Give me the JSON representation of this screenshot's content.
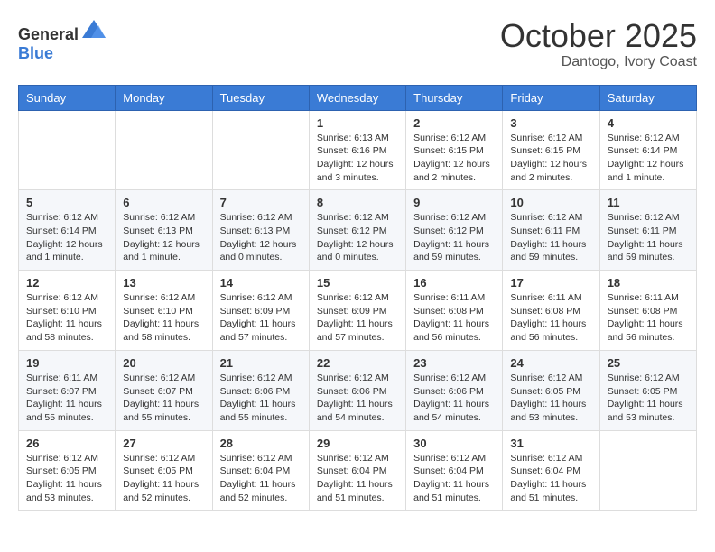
{
  "header": {
    "logo": {
      "general": "General",
      "blue": "Blue"
    },
    "title": "October 2025",
    "subtitle": "Dantogo, Ivory Coast"
  },
  "calendar": {
    "days_of_week": [
      "Sunday",
      "Monday",
      "Tuesday",
      "Wednesday",
      "Thursday",
      "Friday",
      "Saturday"
    ],
    "weeks": [
      [
        {
          "day": "",
          "info": ""
        },
        {
          "day": "",
          "info": ""
        },
        {
          "day": "",
          "info": ""
        },
        {
          "day": "1",
          "info": "Sunrise: 6:13 AM\nSunset: 6:16 PM\nDaylight: 12 hours\nand 3 minutes."
        },
        {
          "day": "2",
          "info": "Sunrise: 6:12 AM\nSunset: 6:15 PM\nDaylight: 12 hours\nand 2 minutes."
        },
        {
          "day": "3",
          "info": "Sunrise: 6:12 AM\nSunset: 6:15 PM\nDaylight: 12 hours\nand 2 minutes."
        },
        {
          "day": "4",
          "info": "Sunrise: 6:12 AM\nSunset: 6:14 PM\nDaylight: 12 hours\nand 1 minute."
        }
      ],
      [
        {
          "day": "5",
          "info": "Sunrise: 6:12 AM\nSunset: 6:14 PM\nDaylight: 12 hours\nand 1 minute."
        },
        {
          "day": "6",
          "info": "Sunrise: 6:12 AM\nSunset: 6:13 PM\nDaylight: 12 hours\nand 1 minute."
        },
        {
          "day": "7",
          "info": "Sunrise: 6:12 AM\nSunset: 6:13 PM\nDaylight: 12 hours\nand 0 minutes."
        },
        {
          "day": "8",
          "info": "Sunrise: 6:12 AM\nSunset: 6:12 PM\nDaylight: 12 hours\nand 0 minutes."
        },
        {
          "day": "9",
          "info": "Sunrise: 6:12 AM\nSunset: 6:12 PM\nDaylight: 11 hours\nand 59 minutes."
        },
        {
          "day": "10",
          "info": "Sunrise: 6:12 AM\nSunset: 6:11 PM\nDaylight: 11 hours\nand 59 minutes."
        },
        {
          "day": "11",
          "info": "Sunrise: 6:12 AM\nSunset: 6:11 PM\nDaylight: 11 hours\nand 59 minutes."
        }
      ],
      [
        {
          "day": "12",
          "info": "Sunrise: 6:12 AM\nSunset: 6:10 PM\nDaylight: 11 hours\nand 58 minutes."
        },
        {
          "day": "13",
          "info": "Sunrise: 6:12 AM\nSunset: 6:10 PM\nDaylight: 11 hours\nand 58 minutes."
        },
        {
          "day": "14",
          "info": "Sunrise: 6:12 AM\nSunset: 6:09 PM\nDaylight: 11 hours\nand 57 minutes."
        },
        {
          "day": "15",
          "info": "Sunrise: 6:12 AM\nSunset: 6:09 PM\nDaylight: 11 hours\nand 57 minutes."
        },
        {
          "day": "16",
          "info": "Sunrise: 6:11 AM\nSunset: 6:08 PM\nDaylight: 11 hours\nand 56 minutes."
        },
        {
          "day": "17",
          "info": "Sunrise: 6:11 AM\nSunset: 6:08 PM\nDaylight: 11 hours\nand 56 minutes."
        },
        {
          "day": "18",
          "info": "Sunrise: 6:11 AM\nSunset: 6:08 PM\nDaylight: 11 hours\nand 56 minutes."
        }
      ],
      [
        {
          "day": "19",
          "info": "Sunrise: 6:11 AM\nSunset: 6:07 PM\nDaylight: 11 hours\nand 55 minutes."
        },
        {
          "day": "20",
          "info": "Sunrise: 6:12 AM\nSunset: 6:07 PM\nDaylight: 11 hours\nand 55 minutes."
        },
        {
          "day": "21",
          "info": "Sunrise: 6:12 AM\nSunset: 6:06 PM\nDaylight: 11 hours\nand 55 minutes."
        },
        {
          "day": "22",
          "info": "Sunrise: 6:12 AM\nSunset: 6:06 PM\nDaylight: 11 hours\nand 54 minutes."
        },
        {
          "day": "23",
          "info": "Sunrise: 6:12 AM\nSunset: 6:06 PM\nDaylight: 11 hours\nand 54 minutes."
        },
        {
          "day": "24",
          "info": "Sunrise: 6:12 AM\nSunset: 6:05 PM\nDaylight: 11 hours\nand 53 minutes."
        },
        {
          "day": "25",
          "info": "Sunrise: 6:12 AM\nSunset: 6:05 PM\nDaylight: 11 hours\nand 53 minutes."
        }
      ],
      [
        {
          "day": "26",
          "info": "Sunrise: 6:12 AM\nSunset: 6:05 PM\nDaylight: 11 hours\nand 53 minutes."
        },
        {
          "day": "27",
          "info": "Sunrise: 6:12 AM\nSunset: 6:05 PM\nDaylight: 11 hours\nand 52 minutes."
        },
        {
          "day": "28",
          "info": "Sunrise: 6:12 AM\nSunset: 6:04 PM\nDaylight: 11 hours\nand 52 minutes."
        },
        {
          "day": "29",
          "info": "Sunrise: 6:12 AM\nSunset: 6:04 PM\nDaylight: 11 hours\nand 51 minutes."
        },
        {
          "day": "30",
          "info": "Sunrise: 6:12 AM\nSunset: 6:04 PM\nDaylight: 11 hours\nand 51 minutes."
        },
        {
          "day": "31",
          "info": "Sunrise: 6:12 AM\nSunset: 6:04 PM\nDaylight: 11 hours\nand 51 minutes."
        },
        {
          "day": "",
          "info": ""
        }
      ]
    ]
  }
}
